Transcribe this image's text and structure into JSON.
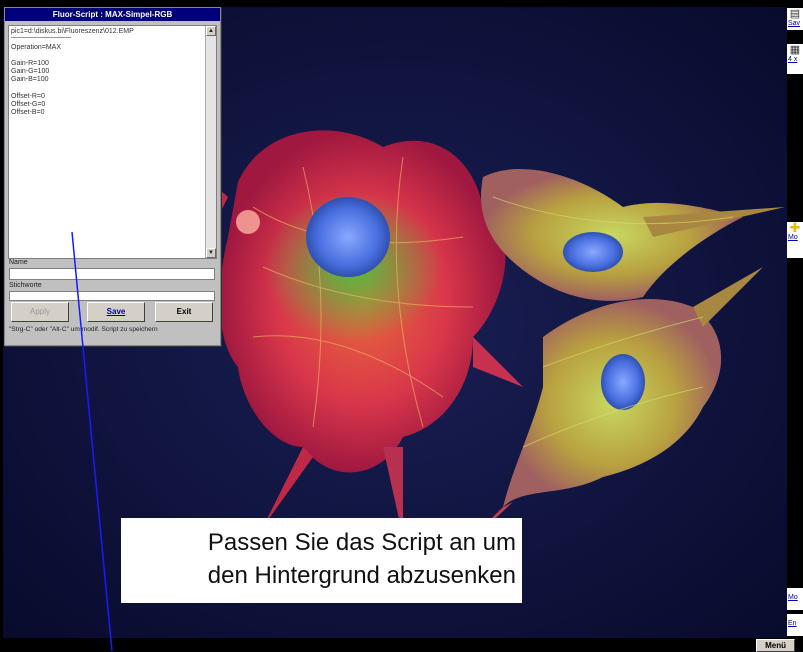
{
  "dialog": {
    "title": "Fluor-Script : MAX-Simpel-RGB",
    "script_lines": [
      "pic1=d:\\diskus.bi\\Fluoreszenz\\012.EMP",
      "",
      "Operation=MAX",
      "",
      "Gain-R=100",
      "Gain-G=100",
      "Gain-B=100",
      "",
      "Offset-R=0",
      "Offset-G=0",
      "Offset-B=0"
    ],
    "name_label": "Name",
    "name_value": "",
    "keywords_label": "Stichworte",
    "keywords_value": "",
    "apply_label": "Apply",
    "save_label": "Save",
    "exit_label": "Exit",
    "hint": "\"Strg-C\" oder \"Alt-C\" um modif. Script zu speichern"
  },
  "callout": {
    "line1": "Passen Sie das Script an um",
    "line2": "den Hintergrund abzusenken"
  },
  "toolstrip": {
    "items": [
      {
        "icon": "save-icon",
        "label": "Sav"
      },
      {
        "icon": "grid-icon",
        "label": "4 x"
      },
      {
        "icon": "crosshair-icon",
        "label": "Mo"
      },
      {
        "icon": "",
        "label": "Mo"
      },
      {
        "icon": "",
        "label": "En"
      }
    ]
  },
  "bottombar": {
    "menu_label": "Menü"
  },
  "colors": {
    "title_bar": "#00007b",
    "dialog_bg": "#c0c0c0",
    "pointer_line": "#1a1aff",
    "image_background": "#0b1035"
  }
}
